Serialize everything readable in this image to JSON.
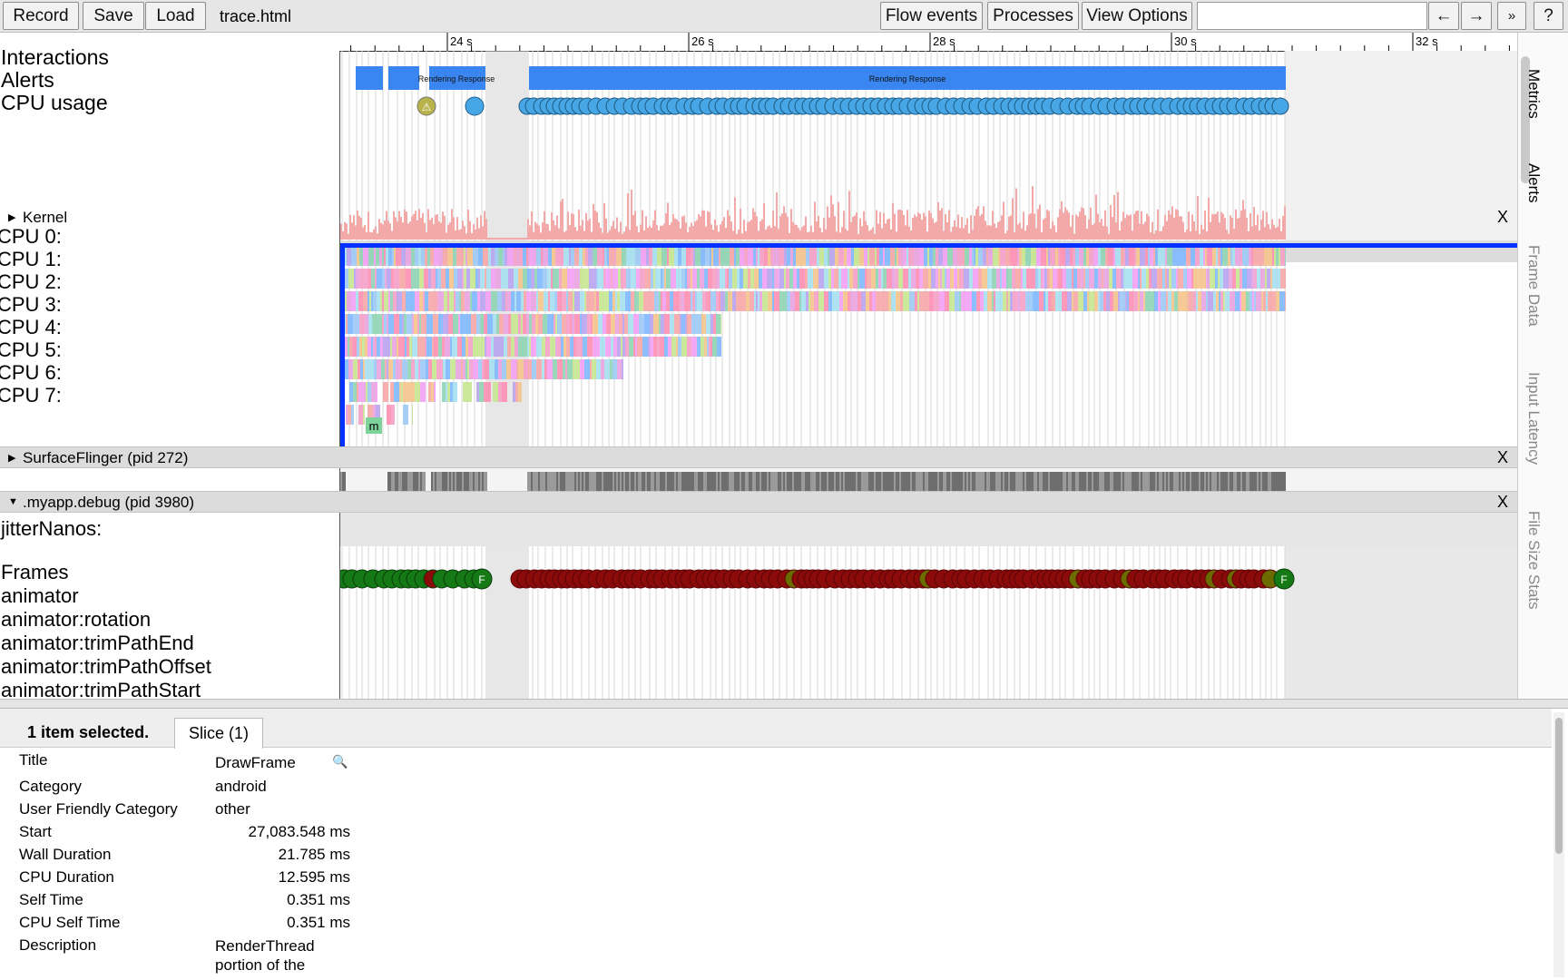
{
  "toolbar": {
    "record_label": "Record",
    "save_label": "Save",
    "load_label": "Load",
    "filename": "trace.html",
    "flow_events_label": "Flow events",
    "processes_label": "Processes",
    "view_options_label": "View Options",
    "search_value": "",
    "prev_label": "←",
    "next_label": "→",
    "more_label": "»",
    "help_label": "?"
  },
  "ruler": {
    "ticks": [
      "24 s",
      "26 s",
      "28 s",
      "30 s",
      "32 s"
    ]
  },
  "tracks": {
    "interactions": "Interactions",
    "alerts": "Alerts",
    "cpu_usage": "CPU usage",
    "rendering_response_1": "Rendering Response",
    "rendering_response_2": "Rendering Response"
  },
  "kernel": {
    "title": "Kernel",
    "close": "X",
    "cpus": [
      "CPU 0:",
      "CPU 1:",
      "CPU 2:",
      "CPU 3:",
      "CPU 4:",
      "CPU 5:",
      "CPU 6:",
      "CPU 7:"
    ],
    "cpu7_marker": "m"
  },
  "surfaceflinger": {
    "title": "SurfaceFlinger (pid 272)",
    "close": "X"
  },
  "myapp": {
    "title": ".myapp.debug (pid 3980)",
    "close": "X",
    "rows": [
      "jitterNanos:",
      "Frames",
      "animator",
      "animator:rotation",
      "animator:trimPathEnd",
      "animator:trimPathOffset",
      "animator:trimPathStart"
    ],
    "frame_marker": "F"
  },
  "side_tabs": [
    "Metrics",
    "Alerts",
    "Frame Data",
    "Input Latency",
    "File Size Stats"
  ],
  "analysis": {
    "selected_text": "1 item selected.",
    "tab_label": "Slice (1)",
    "properties": [
      {
        "label": "Title",
        "value": "DrawFrame"
      },
      {
        "label": "Category",
        "value": "android"
      },
      {
        "label": "User Friendly Category",
        "value": "other"
      },
      {
        "label": "Start",
        "value": "27,083.548 ms"
      },
      {
        "label": "Wall Duration",
        "value": "21.785 ms"
      },
      {
        "label": "CPU Duration",
        "value": "12.595 ms"
      },
      {
        "label": "Self Time",
        "value": "0.351 ms"
      },
      {
        "label": "CPU Self Time",
        "value": "0.351 ms"
      },
      {
        "label": "Description",
        "value": "RenderThread portion of the"
      }
    ]
  },
  "colors": {
    "selection_outline": "#0433ff",
    "interaction_blue": "#3a86f0",
    "cpu_usage_pink": "#f4a9a9",
    "frame_green": "#157a15",
    "frame_red": "#8b0a0a",
    "alert_blue": "#47a6e6",
    "alert_olive": "#b9b34c"
  }
}
